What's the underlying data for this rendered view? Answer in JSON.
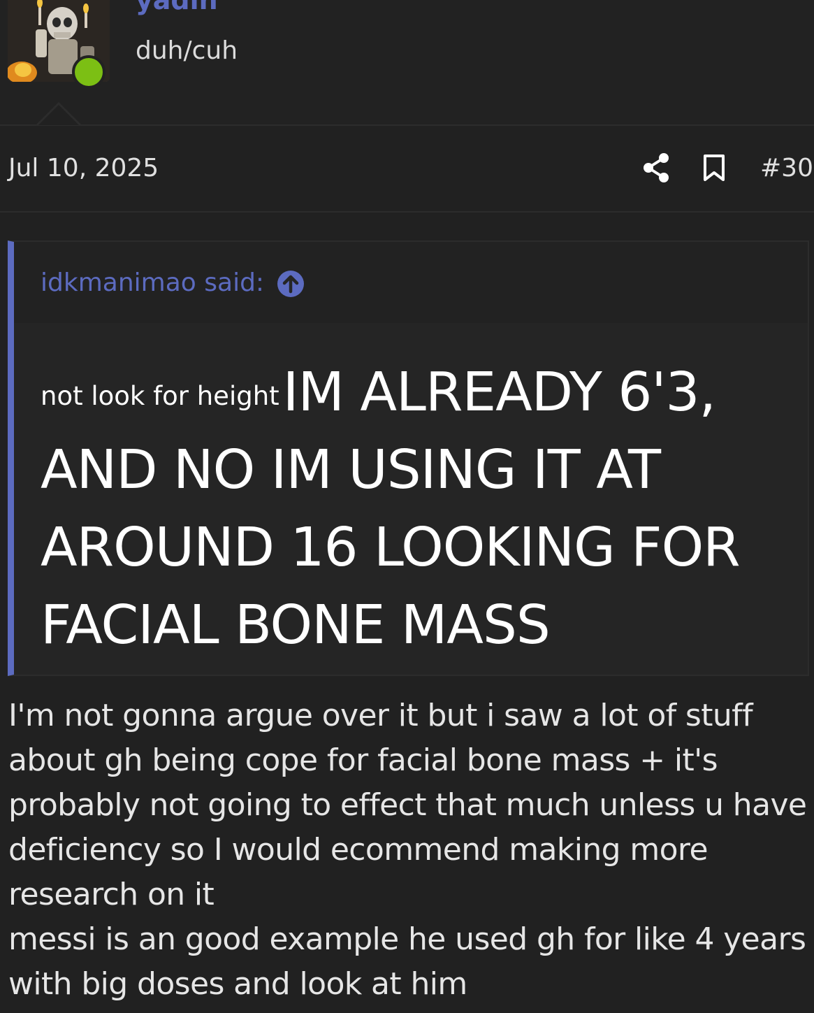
{
  "user": {
    "name": "yadin",
    "title": "duh/cuh",
    "status": "online",
    "status_color": "#7cbf14",
    "name_color": "#5c6bc0"
  },
  "post": {
    "date": "Jul 10, 2025",
    "number": "#30",
    "share_icon": "share-icon",
    "bookmark_icon": "bookmark-icon"
  },
  "quote": {
    "author_label": "idkmanimao said:",
    "jump_icon": "arrow-up-circle-icon",
    "small_text": "not look for height",
    "big_lines": [
      "IM ALREADY 6'3,",
      "AND NO IM USING IT AT",
      "AROUND 16 LOOKING FOR",
      "FACIAL BONE MASS"
    ],
    "accent_color": "#5c6bc0"
  },
  "reply": {
    "lines": [
      "I'm not gonna argue over it but i saw a lot of stuff",
      "about gh being cope for facial bone mass + it's",
      "probably not going to effect that much unless u have",
      "deficiency so I would ecommend making more",
      "research on it",
      "messi is an good example he used gh for like 4 years",
      "with big doses and look at him"
    ]
  }
}
